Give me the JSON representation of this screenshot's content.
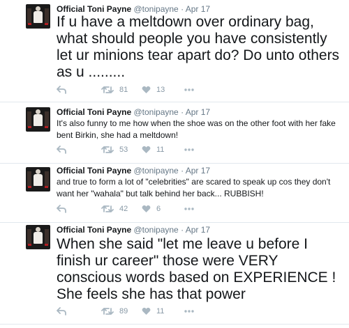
{
  "tweets": [
    {
      "name": "Official Toni Payne",
      "handle": "@tonipayne",
      "dot": "·",
      "date": "Apr 17",
      "text": "If u have a meltdown over ordinary bag, what should people you have consistently let ur minions tear apart do? Do unto others as u .........",
      "retweets": "81",
      "likes": "13"
    },
    {
      "name": "Official Toni Payne",
      "handle": "@tonipayne",
      "dot": "·",
      "date": "Apr 17",
      "text": "It's also funny to me how when the shoe was on the other foot with her fake bent Birkin, she had a meltdown!",
      "retweets": "53",
      "likes": "11"
    },
    {
      "name": "Official Toni Payne",
      "handle": "@tonipayne",
      "dot": "·",
      "date": "Apr 17",
      "text": "and true to form a lot of \"celebrities\" are scared to speak up cos they don't want her \"wahala\" but talk behind her back... RUBBISH!",
      "retweets": "42",
      "likes": "6"
    },
    {
      "name": "Official Toni Payne",
      "handle": "@tonipayne",
      "dot": "·",
      "date": "Apr 17",
      "text": "When she said \"let me leave u before I finish ur career\" those were VERY conscious words based on EXPERIENCE ! She feels she has that power",
      "retweets": "89",
      "likes": "11"
    }
  ],
  "icons": {
    "reply": "reply-icon",
    "retweet": "retweet-icon",
    "like": "heart-icon",
    "more": "more-icon"
  },
  "colors": {
    "text": "#14171a",
    "muted": "#657786",
    "icon": "#aab8c2",
    "divider": "#e1e8ed"
  }
}
